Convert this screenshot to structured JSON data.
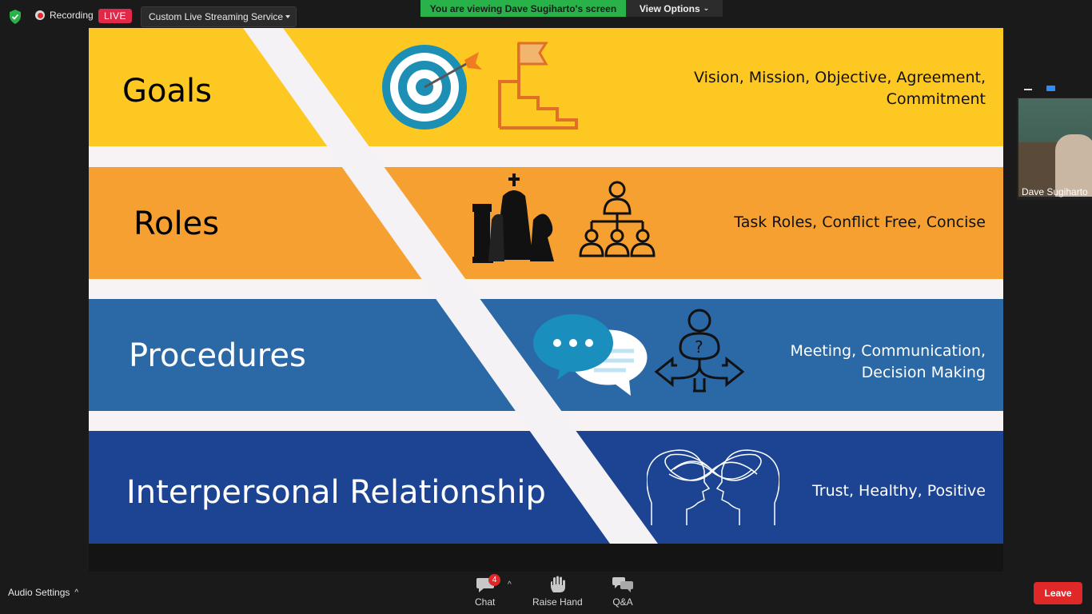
{
  "recording": {
    "label": "Recording",
    "live_badge": "LIVE"
  },
  "stream_service": {
    "label": "Custom Live Streaming Service"
  },
  "share_banner": {
    "text": "You are viewing Dave Sugiharto's screen",
    "view_options": "View Options"
  },
  "slide": {
    "bands": [
      {
        "title": "Goals",
        "description": [
          "Vision, Mission, Objective, Agreement,",
          "Commitment"
        ],
        "color": "#fec823"
      },
      {
        "title": "Roles",
        "description": [
          "Task Roles, Conflict Free, Concise"
        ],
        "color": "#f5a030"
      },
      {
        "title": "Procedures",
        "description": [
          "Meeting, Communication,",
          "Decision Making"
        ],
        "color": "#2b68a6"
      },
      {
        "title": "Interpersonal Relationship",
        "description": [
          "Trust, Healthy, Positive"
        ],
        "color": "#1c4493"
      }
    ],
    "icons": [
      "target-icon",
      "flag-stairs-icon",
      "chess-pieces-icon",
      "org-chart-icon",
      "chat-bubbles-icon",
      "decision-arrows-icon",
      "infinity-heads-icon"
    ]
  },
  "participant": {
    "name": "Dave Sugiharto"
  },
  "toolbar": {
    "audio_settings": "Audio Settings",
    "chat": "Chat",
    "chat_badge": "4",
    "raise_hand": "Raise Hand",
    "qa": "Q&A",
    "leave": "Leave"
  },
  "colors": {
    "live": "#e02848",
    "banner": "#2ab24a",
    "leave": "#e02828",
    "accent": "#2d8cff"
  }
}
